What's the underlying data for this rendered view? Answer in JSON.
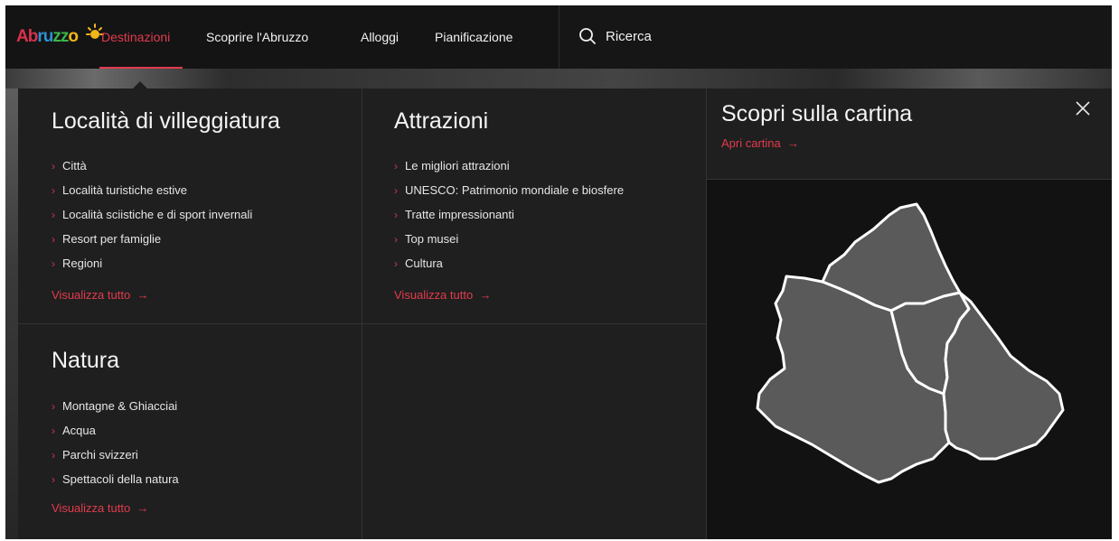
{
  "nav": {
    "logo_parts": [
      "Ab",
      "ru",
      "zz",
      "o"
    ],
    "items": [
      {
        "label": "Destinazioni",
        "active": true
      },
      {
        "label": "Scoprire l'Abruzzo"
      },
      {
        "label": "Alloggi"
      },
      {
        "label": "Pianificazione"
      }
    ],
    "search_label": "Ricerca",
    "search_icon": "search-icon",
    "accent": "#e23b4d"
  },
  "menu": {
    "sections": [
      {
        "title": "Località di villeggiatura",
        "links": [
          "Città",
          "Località turistiche estive",
          "Località sciistiche e di sport invernali",
          "Resort per famiglie",
          "Regioni"
        ],
        "see_all": "Visualizza tutto"
      },
      {
        "title": "Attrazioni",
        "links": [
          "Le migliori attrazioni",
          "UNESCO: Patrimonio mondiale e biosfere",
          "Tratte impressionanti",
          "Top musei",
          "Cultura"
        ],
        "see_all": "Visualizza tutto"
      },
      {
        "title": "Natura",
        "links": [
          "Montagne & Ghiacciai",
          "Acqua",
          "Parchi svizzeri",
          "Spettacoli della natura"
        ],
        "see_all": "Visualizza tutto"
      }
    ],
    "map_panel": {
      "title": "Scopri sulla cartina",
      "open_map": "Apri cartina",
      "close_icon": "close-icon",
      "map_icon": "region-map"
    },
    "arrow": "→",
    "chevron": "›"
  }
}
